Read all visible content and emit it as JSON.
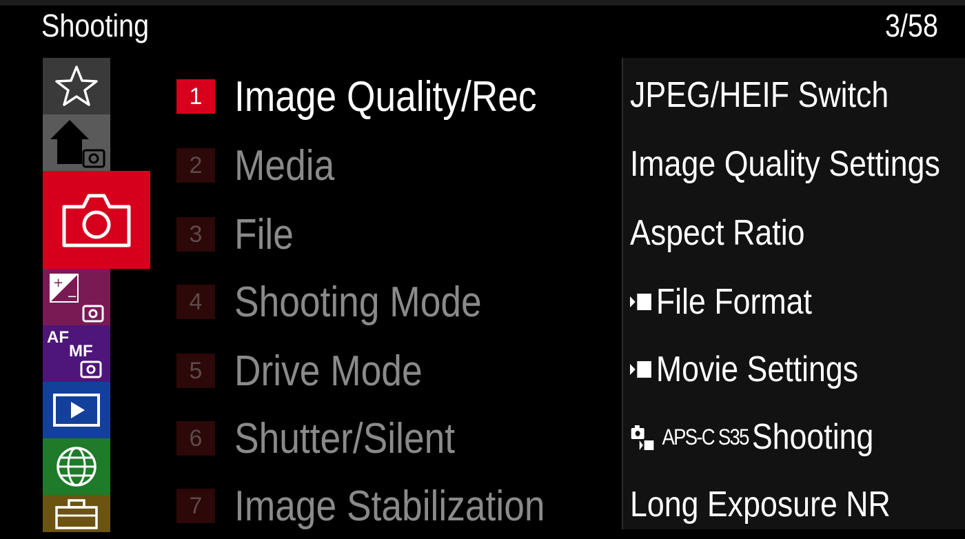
{
  "header": {
    "title": "Shooting",
    "page_indicator": "3/58"
  },
  "tabs": [
    {
      "id": "favorite",
      "icon": "star-outline-icon",
      "color": "#3a3a3a"
    },
    {
      "id": "home",
      "icon": "home-camera-icon",
      "color": "#5a5a5a"
    },
    {
      "id": "shooting",
      "icon": "camera-icon",
      "color": "#d6001c",
      "selected": true
    },
    {
      "id": "exposure",
      "icon": "exposure-compensation-icon",
      "color": "#7a1a55"
    },
    {
      "id": "focus",
      "icon": "af-mf-icon",
      "color": "#4e157a",
      "label": "AF MF"
    },
    {
      "id": "playback",
      "icon": "playback-icon",
      "color": "#13409a"
    },
    {
      "id": "network",
      "icon": "globe-icon",
      "color": "#1f7a2a"
    },
    {
      "id": "setup",
      "icon": "toolbox-icon",
      "color": "#6b5410"
    }
  ],
  "categories": [
    {
      "number": "1",
      "label": "Image Quality/Rec"
    },
    {
      "number": "2",
      "label": "Media"
    },
    {
      "number": "3",
      "label": "File"
    },
    {
      "number": "4",
      "label": "Shooting Mode"
    },
    {
      "number": "5",
      "label": "Drive Mode"
    },
    {
      "number": "6",
      "label": "Shutter/Silent"
    },
    {
      "number": "7",
      "label": "Image Stabilization"
    }
  ],
  "items": [
    {
      "label": "JPEG/HEIF Switch"
    },
    {
      "label": "Image Quality Settings"
    },
    {
      "label": "Aspect Ratio"
    },
    {
      "label": "File Format",
      "prefix_icon": "movie-icon"
    },
    {
      "label": "Movie Settings",
      "prefix_icon": "movie-icon"
    },
    {
      "label": "Shooting",
      "prefix_icon": "still-movie-icon",
      "prefix_text": "APS-C S35"
    },
    {
      "label": "Long Exposure NR"
    }
  ],
  "colors": {
    "accent": "#d6001c",
    "inactive_text": "#8a8a8a",
    "panel_bg": "#121212"
  }
}
